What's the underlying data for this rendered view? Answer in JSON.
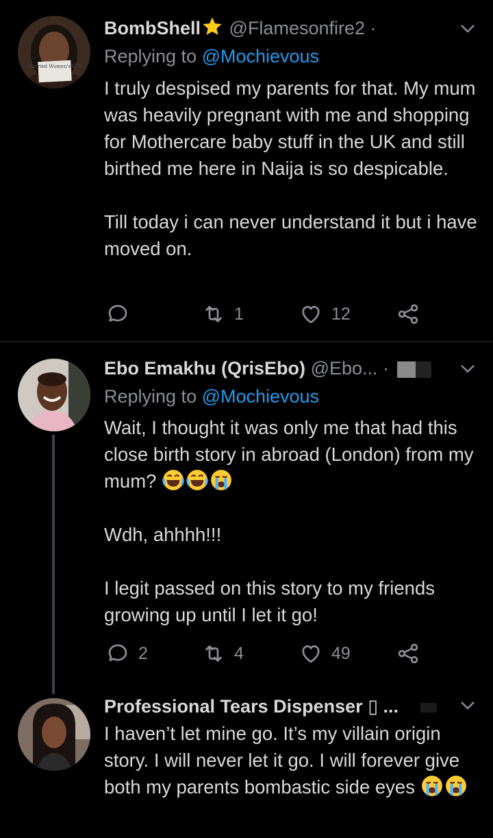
{
  "tweets": [
    {
      "name": "BombShell",
      "handle": "@Flamesonfire2 ·",
      "replying_prefix": "Replying to ",
      "replying_to": "@Mochievous",
      "avatar_sign_text": "Married Women's KTS",
      "text": "I truly despised my parents for that. My mum was heavily pregnant with me and shopping for Mothercare baby stuff in the UK and still birthed me here in Naija is so despicable.\n\nTill today i can never understand it but i have moved on.",
      "replies": "",
      "retweets": "1",
      "likes": "12"
    },
    {
      "name": "Ebo Emakhu (QrisEbo)",
      "handle": "@Ebo... ·",
      "replying_prefix": "Replying to ",
      "replying_to": "@Mochievous",
      "text_line1": "Wait, I thought it was only me that had this close birth story in abroad (London) from my mum? ",
      "text_rest": "\n\nWdh, ahhhh!!!\n\nI legit passed on this story to my friends growing up until I let it go!",
      "replies": "2",
      "retweets": "4",
      "likes": "49"
    },
    {
      "name": "Professional Tears Dispenser",
      "name_suffix": "▯ ...",
      "text": "I haven’t let mine go. It’s my villain origin story. I will never let it go. I will forever give both my parents bombastic side eyes "
    }
  ],
  "colors": {
    "background": "#000000",
    "text": "#d9d9d9",
    "muted": "#8b8f94",
    "link": "#1d9bf0",
    "star": "#ffcc1a"
  },
  "icons": [
    "reply-icon",
    "retweet-icon",
    "like-icon",
    "share-icon",
    "caret-down-icon",
    "star-icon",
    "laughing-emoji-icon",
    "crying-emoji-icon"
  ]
}
